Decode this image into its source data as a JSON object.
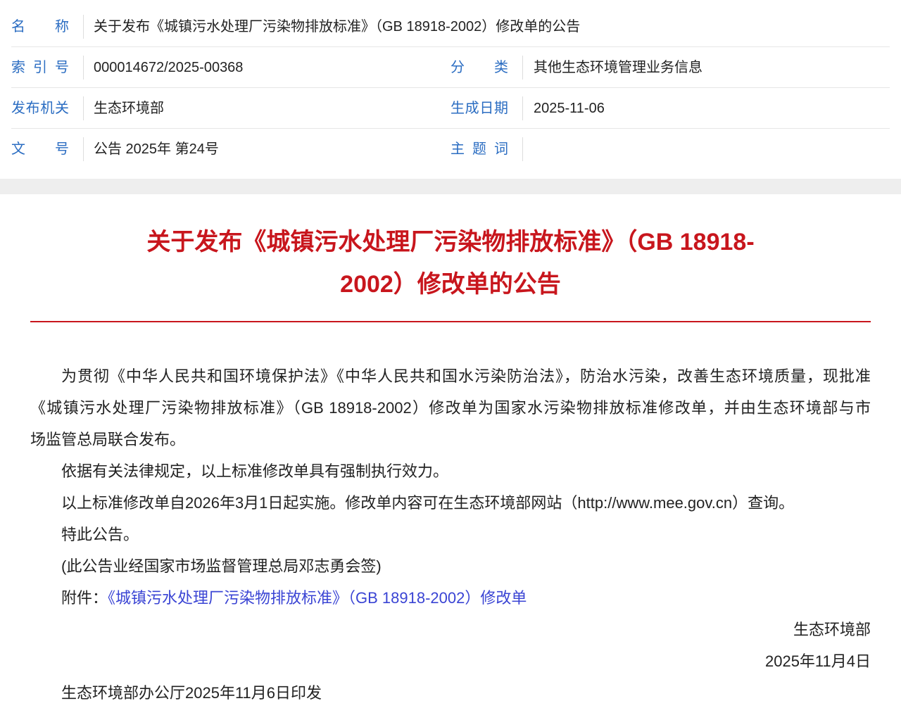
{
  "meta": {
    "name_label": "名　　称",
    "name_value": "关于发布《城镇污水处理厂污染物排放标准》（GB 18918-2002）修改单的公告",
    "index_label": "索 引 号",
    "index_value": "000014672/2025-00368",
    "category_label": "分　　类",
    "category_value": "其他生态环境管理业务信息",
    "issuer_label": "发布机关",
    "issuer_value": "生态环境部",
    "date_label": "生成日期",
    "date_value": "2025-11-06",
    "doc_no_label": "文　　号",
    "doc_no_value": "公告 2025年 第24号",
    "keywords_label": "主 题 词"
  },
  "article": {
    "title_lines": [
      "关于发布《城镇污水处理厂污染物排放标准》（GB 18918-",
      "2002）修改单的公告"
    ],
    "p1_lines": [
      "为贯彻《中华人民共和国环境保护法》《中华人民共和国水污染防治法》，防治水污染，改善生态环境质量，现批准",
      "《城镇污水处理厂污染物排放标准》（GB 18918-2002）修改单为国家水污染物排放标准修改单，并由生态环境部与市",
      "场监管总局联合发布。"
    ],
    "p2": "依据有关法律规定，以上标准修改单具有强制执行效力。",
    "p3": "以上标准修改单自2026年3月1日起实施。修改单内容可在生态环境部网站（http://www.mee.gov.cn）查询。",
    "p4": "特此公告。",
    "p5": "(此公告业经国家市场监督管理总局邓志勇会签)",
    "attachment_label": "附件：",
    "attachment_link": "《城镇污水处理厂污染物排放标准》（GB 18918-2002）修改单",
    "signature_org": "生态环境部",
    "signature_date": "2025年11月4日",
    "print_note": "生态环境部办公厅2025年11月6日印发"
  },
  "colors": {
    "label_blue": "#2b6dc2",
    "title_red": "#c8161d",
    "link_blue": "#3a44d4",
    "text_dark": "#222222"
  }
}
